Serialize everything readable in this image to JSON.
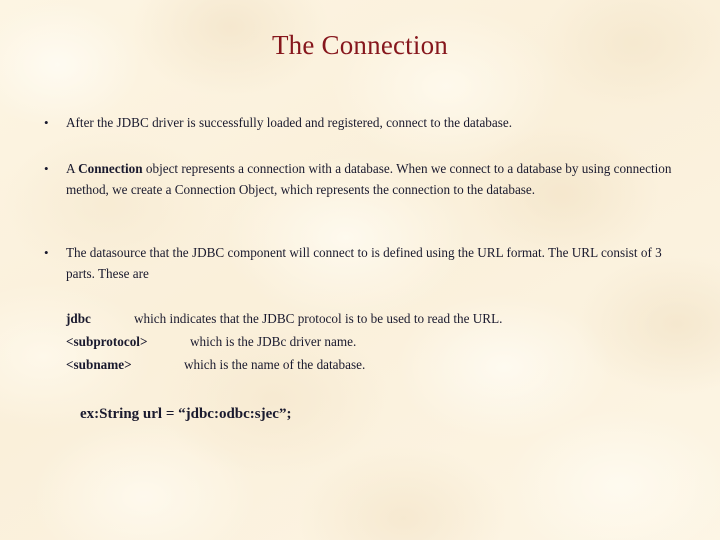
{
  "slide": {
    "title": "The Connection",
    "title_color": "#86161c",
    "body_color": "#1a1a2e",
    "background_color": "#fbf1dc",
    "bullet_glyph": "•",
    "bullets": [
      {
        "mark": "•",
        "text_before_bold": "After the JDBC driver is successfully loaded and registered,  connect to the  database.",
        "bold": "",
        "text_after_bold": ""
      },
      {
        "mark": "•",
        "text_before_bold": "A ",
        "bold": "Connection",
        "text_after_bold": " object represents a connection with a database. When we connect to a database by using connection method, we create a Connection Object, which represents the connection to the database."
      },
      {
        "mark": "•",
        "text_before_bold": "The datasource that the JDBC component will connect to is defined using the URL format. The URL consist of 3 parts. These are",
        "bold": "",
        "text_after_bold": ""
      }
    ],
    "definitions": [
      {
        "term": "jdbc",
        "description": "which indicates that the JDBC protocol is to be used to read the URL."
      },
      {
        "term": "<subprotocol>",
        "description": "which is the  JDBc driver name."
      },
      {
        "term": "<subname>",
        "description": "which is the name of the database."
      }
    ],
    "example": "ex:String  url = “jdbc:odbc:sjec”;"
  }
}
